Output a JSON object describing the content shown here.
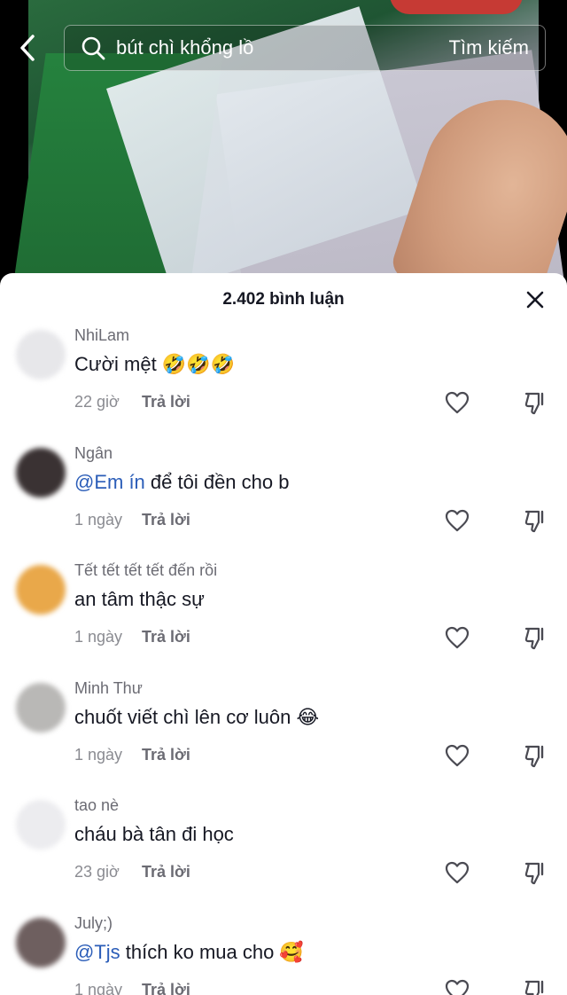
{
  "search": {
    "query": "bút chì khổng lồ",
    "submit_label": "Tìm kiếm"
  },
  "comments_panel": {
    "title": "2.402 bình luận"
  },
  "comments": [
    {
      "user": "NhiLam",
      "mention": "",
      "text": "Cười mệt 🤣🤣🤣",
      "time": "22 giờ",
      "reply": "Trả lời",
      "avatar_color": "#e7e7ea"
    },
    {
      "user": "Ngân",
      "mention": "@Em ín",
      "text": " để tôi đền cho b",
      "time": "1 ngày",
      "reply": "Trả lời",
      "avatar_color": "#3a3233"
    },
    {
      "user": "Tết tết tết tết đến rồi",
      "mention": "",
      "text": "an tâm thậc sự",
      "time": "1 ngày",
      "reply": "Trả lời",
      "avatar_color": "#e9a84a"
    },
    {
      "user": "Minh Thư",
      "mention": "",
      "text": "chuốt viết chì lên cơ luôn 😂",
      "time": "1 ngày",
      "reply": "Trả lời",
      "avatar_color": "#b9b8b6"
    },
    {
      "user": "tao nè",
      "mention": "",
      "text": "cháu bà tân đi học",
      "time": "23 giờ",
      "reply": "Trả lời",
      "avatar_color": "#ececef"
    },
    {
      "user": "July;)",
      "mention": "@Tjs",
      "text": " thích ko mua cho 🥰",
      "time": "1 ngày",
      "reply": "Trả lời",
      "avatar_color": "#6e5f5f"
    }
  ]
}
